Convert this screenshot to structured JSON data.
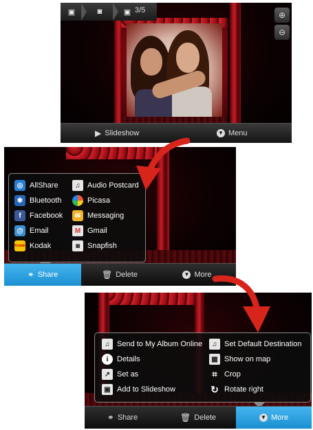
{
  "screen1": {
    "counter": "3/5",
    "slideshow_label": "Slideshow",
    "menu_label": "Menu"
  },
  "share_menu": {
    "items": [
      {
        "label": "AllShare",
        "icon": "allshare-icon"
      },
      {
        "label": "Audio Postcard",
        "icon": "audio-postcard-icon"
      },
      {
        "label": "Bluetooth",
        "icon": "bluetooth-icon"
      },
      {
        "label": "Picasa",
        "icon": "picasa-icon"
      },
      {
        "label": "Facebook",
        "icon": "facebook-icon"
      },
      {
        "label": "Messaging",
        "icon": "messaging-icon"
      },
      {
        "label": "Email",
        "icon": "email-icon"
      },
      {
        "label": "Gmail",
        "icon": "gmail-icon"
      },
      {
        "label": "Kodak",
        "icon": "kodak-icon"
      },
      {
        "label": "Snapfish",
        "icon": "snapfish-icon"
      }
    ],
    "logo_letters": {
      "facebook": "f",
      "gmail": "M",
      "kodak": "Kodak"
    }
  },
  "screen2_bar": {
    "share": "Share",
    "delete": "Delete",
    "more": "More"
  },
  "more_menu": {
    "items": [
      {
        "label": "Send to My Album Online",
        "icon": "album-online-icon"
      },
      {
        "label": "Set Default Destination",
        "icon": "default-destination-icon"
      },
      {
        "label": "Details",
        "icon": "info-icon"
      },
      {
        "label": "Show on map",
        "icon": "map-icon"
      },
      {
        "label": "Set as",
        "icon": "set-as-icon"
      },
      {
        "label": "Crop",
        "icon": "crop-icon"
      },
      {
        "label": "Add to Slideshow",
        "icon": "slideshow-add-icon"
      },
      {
        "label": "Rotate right",
        "icon": "rotate-right-icon"
      }
    ]
  },
  "screen3_bar": {
    "share": "Share",
    "delete": "Delete",
    "more": "More"
  },
  "colors": {
    "highlight": "#2ea3e3",
    "arrow": "#d8251c",
    "curtain": "#b3141d"
  }
}
